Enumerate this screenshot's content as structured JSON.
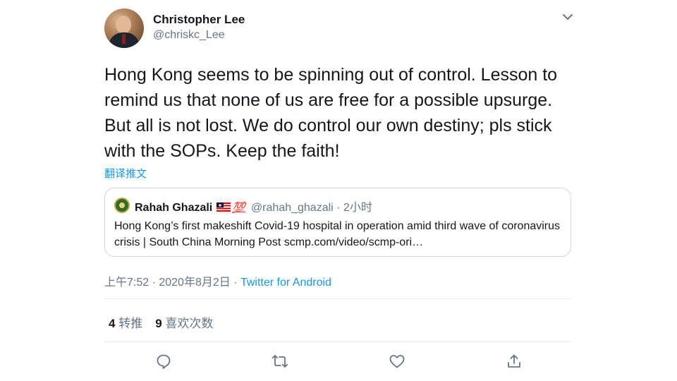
{
  "author": {
    "display_name": "Christopher Lee",
    "handle": "@chriskc_Lee"
  },
  "tweet": {
    "text": "Hong Kong seems to be spinning out of control. Lesson to remind us that none of us are free for a possible upsurge. But all is not lost. We do control our own destiny; pls stick with the SOPs. Keep the faith!",
    "translate_label": "翻译推文"
  },
  "quote": {
    "display_name": "Rahah Ghazali",
    "emoji_hundred": "💯",
    "handle_time": "@rahah_ghazali · 2小时",
    "text": "Hong Kong’s first makeshift Covid-19 hospital in operation amid third wave of coronavirus crisis | South China Morning Post scmp.com/video/scmp-ori…"
  },
  "meta": {
    "timestamp": "上午7:52 · 2020年8月2日 · ",
    "source": "Twitter for Android"
  },
  "stats": {
    "retweets_count": "4",
    "retweets_label": "转推",
    "likes_count": "9",
    "likes_label": "喜欢次数"
  },
  "icons": {
    "more": "chevron-down-icon",
    "reply": "reply-icon",
    "retweet": "retweet-icon",
    "like": "heart-icon",
    "share": "share-icon"
  },
  "colors": {
    "link": "#1b95e0",
    "secondary_text": "#657786",
    "border": "#ccd6dd"
  }
}
